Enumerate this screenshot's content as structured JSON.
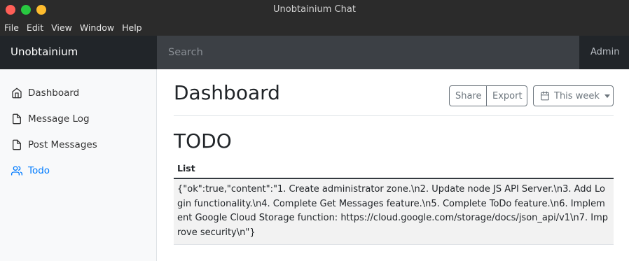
{
  "window": {
    "title": "Unobtainium Chat"
  },
  "menu": [
    "File",
    "Edit",
    "View",
    "Window",
    "Help"
  ],
  "navbar": {
    "brand": "Unobtainium",
    "search_placeholder": "Search",
    "admin_label": "Admin"
  },
  "sidebar": {
    "items": [
      {
        "label": "Dashboard",
        "icon": "home-icon",
        "active": false
      },
      {
        "label": "Message Log",
        "icon": "file-icon",
        "active": false
      },
      {
        "label": "Post Messages",
        "icon": "file-icon",
        "active": false
      },
      {
        "label": "Todo",
        "icon": "users-icon",
        "active": true
      }
    ]
  },
  "main": {
    "title": "Dashboard",
    "share_label": "Share",
    "export_label": "Export",
    "period_label": "This week",
    "section_title": "TODO",
    "table": {
      "header": "List",
      "rows": [
        "{\"ok\":true,\"content\":\"1. Create administrator zone.\\n2. Update node JS API Server.\\n3. Add Login functionality.\\n4. Complete Get Messages feature.\\n5. Complete ToDo feature.\\n6. Implement Google Cloud Storage function: https://cloud.google.com/storage/docs/json_api/v1\\n7. Improve security\\n\"}"
      ]
    }
  },
  "colors": {
    "accent": "#007bff",
    "navbar_bg": "#343a40",
    "brand_bg": "#212529",
    "sidebar_bg": "#f8f9fa"
  }
}
